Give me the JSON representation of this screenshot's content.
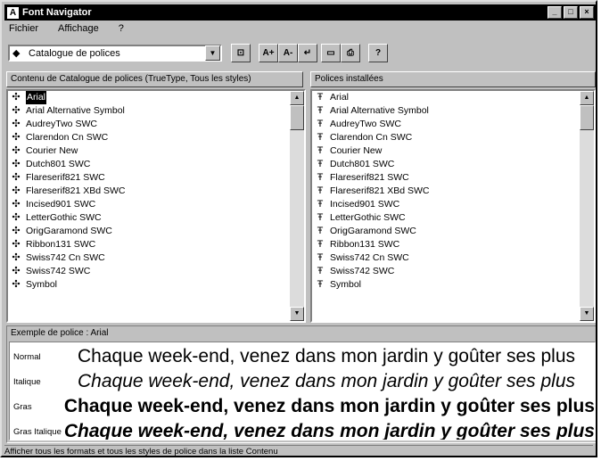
{
  "window": {
    "title": "Font Navigator",
    "app_icon": "A"
  },
  "title_buttons": [
    {
      "name": "minimize-icon",
      "glyph": "_"
    },
    {
      "name": "maximize-icon",
      "glyph": "□"
    },
    {
      "name": "close-icon",
      "glyph": "×"
    }
  ],
  "menu": [
    "Fichier",
    "Affichage",
    "?"
  ],
  "toolbar": {
    "catalog_select": {
      "value": "Catalogue de polices",
      "icon": "catalog-icon"
    },
    "buttons": [
      {
        "name": "catalog-search-icon",
        "glyph": "⊡"
      },
      {
        "name": "add-font-icon",
        "glyph": "A+"
      },
      {
        "name": "remove-font-icon",
        "glyph": "A-"
      },
      {
        "name": "install-font-icon",
        "glyph": "↵"
      },
      {
        "name": "properties-icon",
        "glyph": "▭"
      },
      {
        "name": "print-icon",
        "glyph": "⎙"
      },
      {
        "name": "help-icon",
        "glyph": "?"
      }
    ]
  },
  "left_panel": {
    "header": "Contenu de Catalogue de polices     (TrueType, Tous les styles)",
    "items": [
      "Arial",
      "Arial Alternative Symbol",
      "AudreyTwo SWC",
      "Clarendon Cn SWC",
      "Courier New",
      "Dutch801 SWC",
      "Flareserif821 SWC",
      "Flareserif821 XBd SWC",
      "Incised901 SWC",
      "LetterGothic SWC",
      "OrigGaramond SWC",
      "Ribbon131 SWC",
      "Swiss742 Cn SWC",
      "Swiss742 SWC",
      "Symbol"
    ]
  },
  "right_panel": {
    "header": "Polices installées",
    "items": [
      "Arial",
      "Arial Alternative Symbol",
      "AudreyTwo SWC",
      "Clarendon Cn SWC",
      "Courier New",
      "Dutch801 SWC",
      "Flareserif821 SWC",
      "Flareserif821 XBd SWC",
      "Incised901 SWC",
      "LetterGothic SWC",
      "OrigGaramond SWC",
      "Ribbon131 SWC",
      "Swiss742 Cn SWC",
      "Swiss742 SWC",
      "Symbol"
    ]
  },
  "preview": {
    "header": "Exemple de police : Arial",
    "sample_text": "Chaque week-end, venez dans mon jardin y goûter ses plus",
    "styles": [
      {
        "name": "Normal",
        "weight": "normal",
        "style": "normal"
      },
      {
        "name": "Italique",
        "weight": "normal",
        "style": "italic"
      },
      {
        "name": "Gras",
        "weight": "bold",
        "style": "normal"
      },
      {
        "name": "Gras Italique",
        "weight": "bold",
        "style": "italic"
      }
    ]
  },
  "status": "Afficher tous les formats et tous les styles de police dans la liste Contenu"
}
